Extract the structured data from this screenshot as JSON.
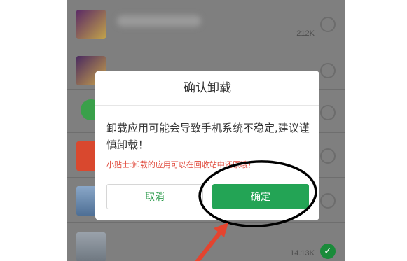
{
  "list": {
    "items": [
      {
        "size": "212K",
        "checked": false
      },
      {
        "size": "",
        "checked": false
      },
      {
        "size": "",
        "checked": false
      },
      {
        "size": "",
        "checked": false
      },
      {
        "size": "",
        "checked": false
      },
      {
        "size": "",
        "checked": false
      },
      {
        "size": "14.13K",
        "checked": true
      }
    ]
  },
  "dialog": {
    "title": "确认卸载",
    "message": "卸载应用可能会导致手机系统不稳定,建议谨慎卸载！",
    "tip": "小贴士:卸载的应用可以在回收站中还原哦！",
    "cancel_label": "取消",
    "confirm_label": "确定"
  },
  "colors": {
    "confirm": "#23a455",
    "cancel_text": "#2a9a4a",
    "tip_text": "#e04a3c",
    "annotation": "#000000",
    "arrow": "#e4442f"
  },
  "icons": {
    "checked_radio": "check-icon",
    "radio": "radio-icon"
  }
}
